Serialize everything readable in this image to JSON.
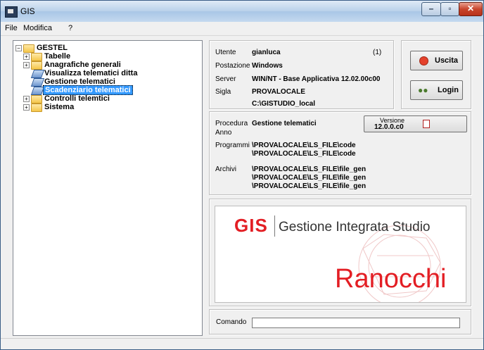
{
  "window": {
    "title": "GIS"
  },
  "menu": {
    "items": [
      "File",
      "Modifica",
      "?"
    ]
  },
  "tree": {
    "root": "GESTEL",
    "items": [
      {
        "label": "Tabelle",
        "type": "folder"
      },
      {
        "label": "Anagrafiche generali",
        "type": "folder"
      },
      {
        "label": "Visualizza telematici ditta",
        "type": "doc"
      },
      {
        "label": "Gestione telematici",
        "type": "doc"
      },
      {
        "label": "Scadenziario telematici",
        "type": "doc",
        "selected": true
      },
      {
        "label": "Controlli telemtici",
        "type": "folder"
      },
      {
        "label": "Sistema",
        "type": "folder"
      }
    ]
  },
  "user_info": {
    "utente_label": "Utente",
    "utente_value": "gianluca",
    "utente_count": "(1)",
    "postazione_label": "Postazione",
    "postazione_value": "Windows",
    "server_label": "Server",
    "server_value": "WIN/NT - Base Applicativa 12.02.00c00",
    "sigla_label": "Sigla",
    "sigla_value": "PROVALOCALE",
    "path_value": "C:\\GISTUDIO_local"
  },
  "buttons": {
    "uscita": "Uscita",
    "login": "Login"
  },
  "procedura": {
    "procedura_label": "Procedura",
    "procedura_value": "Gestione telematici",
    "anno_label": "Anno",
    "versione_label": "Versione",
    "versione_value": "12.0.0.c0",
    "programmi_label": "Programmi",
    "programmi_values": [
      "\\PROVALOCALE\\LS_FILE\\code",
      "\\PROVALOCALE\\LS_FILE\\code"
    ],
    "archivi_label": "Archivi",
    "archivi_values": [
      "\\PROVALOCALE\\LS_FILE\\file_gen",
      "\\PROVALOCALE\\LS_FILE\\file_gen",
      "\\PROVALOCALE\\LS_FILE\\file_gen"
    ]
  },
  "logo": {
    "brand": "GIS",
    "tagline": "Gestione Integrata Studio",
    "company": "Ranocchi"
  },
  "comando": {
    "label": "Comando",
    "value": ""
  },
  "colors": {
    "brand_red": "#e31e24",
    "selection": "#3399ff"
  }
}
